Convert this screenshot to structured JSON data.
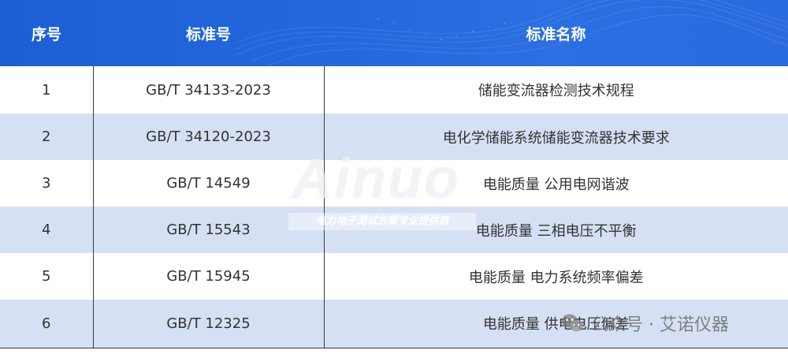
{
  "table": {
    "headers": [
      "序号",
      "标准号",
      "标准名称"
    ],
    "rows": [
      {
        "no": "1",
        "code": "GB/T 34133-2023",
        "name": "储能变流器检测技术规程"
      },
      {
        "no": "2",
        "code": "GB/T 34120-2023",
        "name": "电化学储能系统储能变流器技术要求"
      },
      {
        "no": "3",
        "code": "GB/T 14549",
        "name": "电能质量 公用电网谐波"
      },
      {
        "no": "4",
        "code": "GB/T 15543",
        "name": "电能质量 三相电压不平衡"
      },
      {
        "no": "5",
        "code": "GB/T 15945",
        "name": "电能质量 电力系统频率偏差"
      },
      {
        "no": "6",
        "code": "GB/T 12325",
        "name": "电能质量 供电电压偏差"
      }
    ]
  },
  "watermark": {
    "brand": "Ainuo",
    "tagline": "电力电子测试方案专业提供商",
    "wechat": "公众号 · 艾诺仪器"
  },
  "colors": {
    "header": "#2467dc",
    "row_alt": "#d5e0f4",
    "row": "#ffffff"
  }
}
